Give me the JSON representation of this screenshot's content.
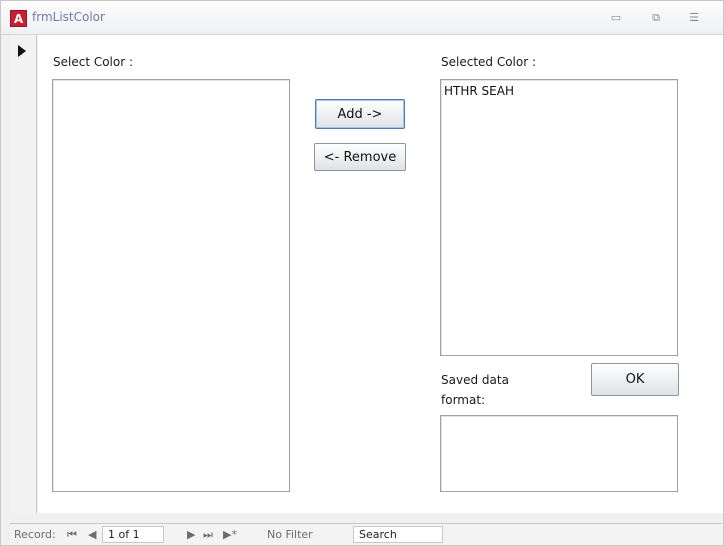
{
  "window": {
    "title": "frmListColor",
    "app_icon": "A",
    "minimize_glyph": "▭",
    "restore_glyph": "⧉",
    "close_glyph": "☰"
  },
  "form": {
    "select_label": "Select Color :",
    "selected_label": "Selected Color :",
    "available_items": [],
    "selected_items": [
      "HTHR SEAH"
    ],
    "add_button": "Add ->",
    "remove_button": "<- Remove",
    "saved_label": "Saved data format:",
    "ok_button": "OK",
    "saved_value": ""
  },
  "statusbar": {
    "record_label": "Record:",
    "first_glyph": "⏮",
    "prev_glyph": "◀",
    "position": "1 of 1",
    "next_glyph": "▶",
    "last_glyph": "⏭",
    "new_glyph": "▶*",
    "filter_label": "No Filter",
    "search_placeholder": "Search"
  },
  "colors": {
    "accent": "#c9202f",
    "title_text": "#6f7aa3"
  }
}
